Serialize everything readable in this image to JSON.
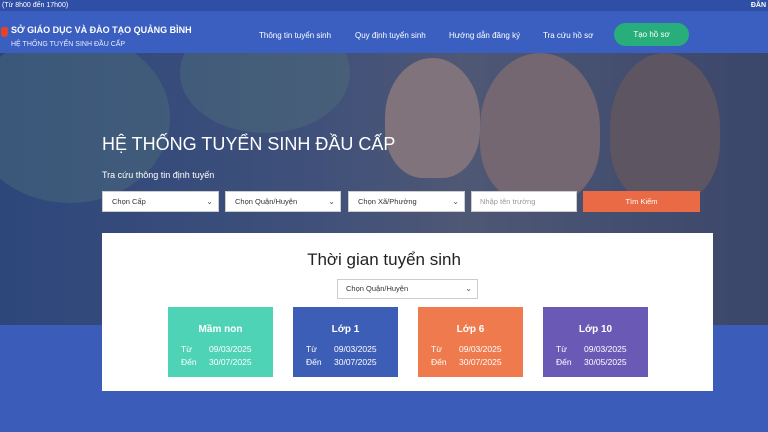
{
  "topbar": {
    "hours": "(Từ 8h00 đến 17h00)",
    "login": "ĐĂN"
  },
  "header": {
    "title": "SỞ GIÁO DỤC VÀ ĐÀO TẠO QUẢNG BÌNH",
    "subtitle": "HỆ THỐNG TUYỂN SINH ĐẦU CẤP",
    "nav": [
      "Thông tin tuyển sinh",
      "Quy định tuyển sinh",
      "Hướng dẫn đăng ký",
      "Tra cứu hồ sơ"
    ],
    "cta": "Tạo hồ sơ"
  },
  "hero": {
    "title": "HỆ THỐNG TUYỂN SINH ĐẦU CẤP",
    "subtitle": "Tra cứu thông tin định tuyến",
    "select_level": "Chọn Cấp",
    "select_district": "Chọn Quận/Huyện",
    "select_ward": "Chọn Xã/Phường",
    "school_placeholder": "Nhập tên trường",
    "search_label": "Tìm Kiếm"
  },
  "schedule": {
    "title": "Thời gian tuyển sinh",
    "district_select": "Chọn Quận/Huyện",
    "from_label": "Từ",
    "to_label": "Đến",
    "cards": [
      {
        "title": "Mầm non",
        "from": "09/03/2025",
        "to": "30/07/2025",
        "color": "#4fd3b6"
      },
      {
        "title": "Lớp 1",
        "from": "09/03/2025",
        "to": "30/07/2025",
        "color": "#3d5eb6"
      },
      {
        "title": "Lớp 6",
        "from": "09/03/2025",
        "to": "30/07/2025",
        "color": "#ef7a4d"
      },
      {
        "title": "Lớp 10",
        "from": "09/03/2025",
        "to": "30/05/2025",
        "color": "#6b5ab5"
      }
    ]
  },
  "colors": {
    "brand": "#3a5fc0",
    "cta": "#27ae7a",
    "search": "#e96a45"
  },
  "icons": {
    "dropdown": "chevron-down-icon",
    "logo": "shield-logo"
  }
}
